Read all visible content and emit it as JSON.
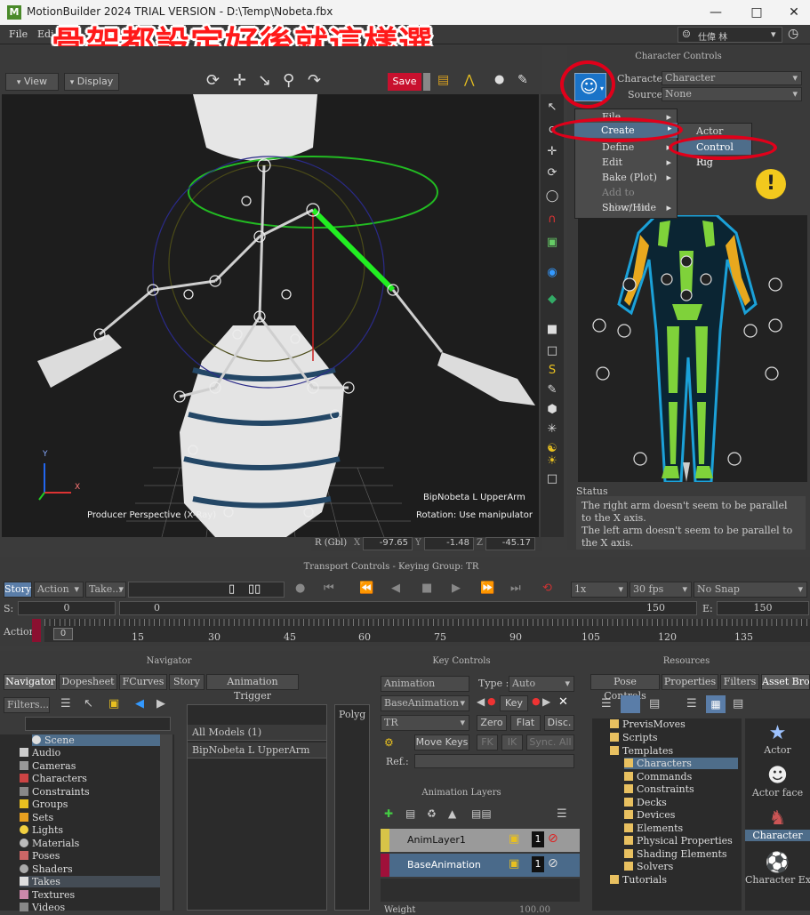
{
  "window": {
    "title": "MotionBuilder 2024 TRIAL VERSION - D:\\Temp\\Nobeta.fbx",
    "user": "仕偉 林"
  },
  "overlay_caption": "骨架都設定好後就這樣選",
  "menubar": [
    "File",
    "Edi",
    "Ac"
  ],
  "viewer": {
    "view_label": "View",
    "display_label": "Display",
    "save_label": "Save",
    "perspective": "Producer Perspective (X-Ray)",
    "selected_bone": "BipNobeta L UpperArm",
    "manipulator": "Rotation: Use manipulator",
    "axis_x": "X",
    "axis_y": "Y",
    "readout": {
      "label": "R (Gbl)",
      "x_label": "X",
      "x": "-97.65",
      "y_label": "Y",
      "y": "-1.48",
      "z_label": "Z",
      "z": "-45.17"
    }
  },
  "character_controls": {
    "title": "Character Controls",
    "character_label": "Character:",
    "character_value": "Character",
    "source_label": "Source:",
    "source_value": "None",
    "menu": [
      {
        "label": "File",
        "disabled": false
      },
      {
        "label": "Create",
        "disabled": false
      },
      {
        "label": "Define",
        "disabled": false
      },
      {
        "label": "Edit",
        "disabled": false
      },
      {
        "label": "Bake (Plot)",
        "disabled": false
      },
      {
        "label": "Add to Selection",
        "disabled": true
      },
      {
        "label": "Show/Hide",
        "disabled": false
      }
    ],
    "submenu": [
      "Actor",
      "Control Rig"
    ],
    "status_label": "Status",
    "status_lines": [
      "The right arm doesn't seem to be parallel to the X axis.",
      "The left arm doesn't seem to be parallel to the X axis."
    ],
    "accent": "#ffd21f",
    "highlight": "#e0001a"
  },
  "transport": {
    "title": "Transport Controls  -  Keying Group: TR",
    "story_label": "Story",
    "action_label": "Action",
    "take_label": "Take...",
    "speed": "1x",
    "fps": "30 fps",
    "snap": "No Snap",
    "start_label": "S:",
    "start_value": "0",
    "current": "0",
    "end_marker": "150",
    "end_label": "E:",
    "end_value": "150",
    "action_row_label": "Action",
    "frame_value": "0",
    "ticks": [
      "15",
      "30",
      "45",
      "60",
      "75",
      "90",
      "105",
      "120",
      "135"
    ]
  },
  "navigator": {
    "title": "Navigator",
    "tabs": [
      "Navigator",
      "Dopesheet",
      "FCurves",
      "Story",
      "Animation Trigger"
    ],
    "filters_label": "Filters...",
    "tree": [
      "Scene",
      "Audio",
      "Cameras",
      "Characters",
      "Constraints",
      "Groups",
      "Sets",
      "Lights",
      "Materials",
      "Poses",
      "Shaders",
      "Takes",
      "Textures",
      "Videos"
    ],
    "models": [
      "All Models (1)",
      "BipNobeta L UpperArm"
    ],
    "col_header": "Polyg"
  },
  "key_controls": {
    "title": "Key Controls",
    "animation_label": "Animation",
    "type_label": "Type :",
    "type_value": "Auto",
    "layer_value": "BaseAnimation",
    "key_label": "Key",
    "tr_value": "TR",
    "zero_label": "Zero",
    "flat_label": "Flat",
    "disc_label": "Disc.",
    "move_keys_label": "Move Keys",
    "fk_label": "FK",
    "ik_label": "IK",
    "sync_label": "Sync. All",
    "ref_label": "Ref.:",
    "layers_title": "Animation Layers",
    "layers": [
      "AnimLayer1",
      "BaseAnimation"
    ],
    "layer_num": "1",
    "weight_label": "Weight",
    "weight_value": "100.00"
  },
  "resources": {
    "title": "Resources",
    "tabs": [
      "Pose Controls",
      "Properties",
      "Filters",
      "Asset Brow"
    ],
    "tree": [
      "PrevisMoves",
      "Scripts",
      "Templates",
      "Characters",
      "Commands",
      "Constraints",
      "Decks",
      "Devices",
      "Elements",
      "Physical Properties",
      "Shading Elements",
      "Solvers",
      "Tutorials"
    ],
    "assets": [
      "Actor",
      "Actor face",
      "Character",
      "Character Ext..."
    ]
  }
}
